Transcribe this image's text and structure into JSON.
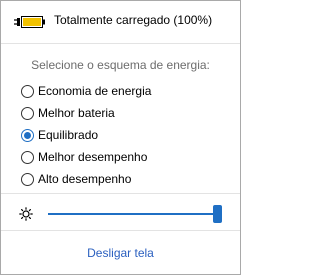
{
  "battery": {
    "status": "Totalmente carregado (100%)",
    "icon": "battery-full-plugged-icon",
    "level": 1.0
  },
  "power_plans": {
    "title": "Selecione o esquema de energia:",
    "selected": "Equilibrado",
    "items": [
      {
        "label": "Economia de energia",
        "checked": false
      },
      {
        "label": "Melhor bateria",
        "checked": false
      },
      {
        "label": "Equilibrado",
        "checked": true
      },
      {
        "label": "Melhor desempenho",
        "checked": false
      },
      {
        "label": "Alto desempenho",
        "checked": false
      }
    ]
  },
  "brightness": {
    "icon": "brightness-sun-icon",
    "level": 0.97
  },
  "footer": {
    "link_label": "Desligar tela"
  },
  "colors": {
    "accent": "#1f6fc4",
    "battery_fill": "#f2c200",
    "link": "#2a5fbf",
    "muted_text": "#6d6d6d"
  }
}
